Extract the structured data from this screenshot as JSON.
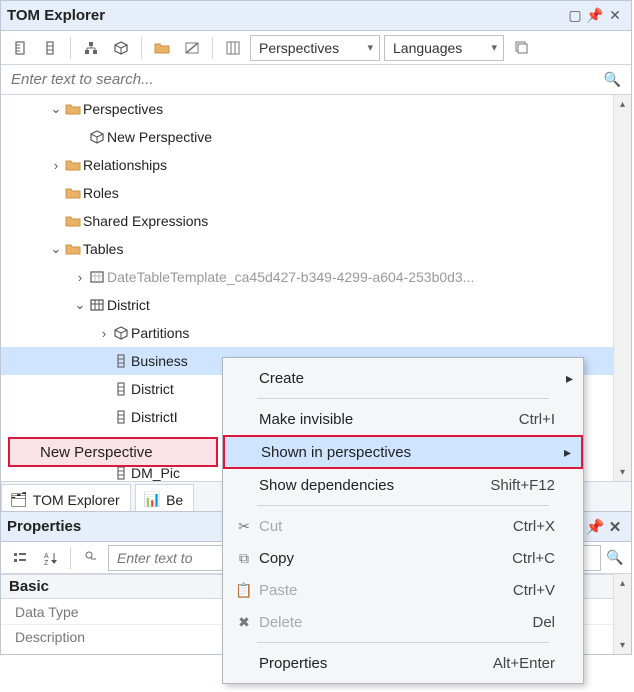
{
  "explorer": {
    "title": "TOM Explorer",
    "perspectives_dd": "Perspectives",
    "languages_dd": "Languages",
    "search_placeholder": "Enter text to search...",
    "nodes": {
      "perspectives": "Perspectives",
      "new_perspective": "New Perspective",
      "relationships": "Relationships",
      "roles": "Roles",
      "shared_expr": "Shared Expressions",
      "tables": "Tables",
      "date_template": "DateTableTemplate_ca45d427-b349-4299-a604-253b0d3...",
      "district": "District",
      "partitions": "Partitions",
      "col_business": "Business",
      "col_district": "District",
      "col_district_i": "DistrictI",
      "col_dm_pic": "DM_Pic"
    },
    "tag_label": "New Perspective",
    "tabs": {
      "tom": "TOM Explorer",
      "be": "Be"
    }
  },
  "contextmenu": {
    "create": "Create",
    "make_invisible": "Make invisible",
    "make_invisible_sc": "Ctrl+I",
    "shown": "Shown in perspectives",
    "show_dep": "Show dependencies",
    "show_dep_sc": "Shift+F12",
    "cut": "Cut",
    "cut_sc": "Ctrl+X",
    "copy": "Copy",
    "copy_sc": "Ctrl+C",
    "paste": "Paste",
    "paste_sc": "Ctrl+V",
    "delete": "Delete",
    "delete_sc": "Del",
    "properties": "Properties",
    "properties_sc": "Alt+Enter"
  },
  "properties": {
    "title": "Properties",
    "search_placeholder": "Enter text to",
    "group_basic": "Basic",
    "row_datatype": "Data Type",
    "row_description": "Description"
  }
}
